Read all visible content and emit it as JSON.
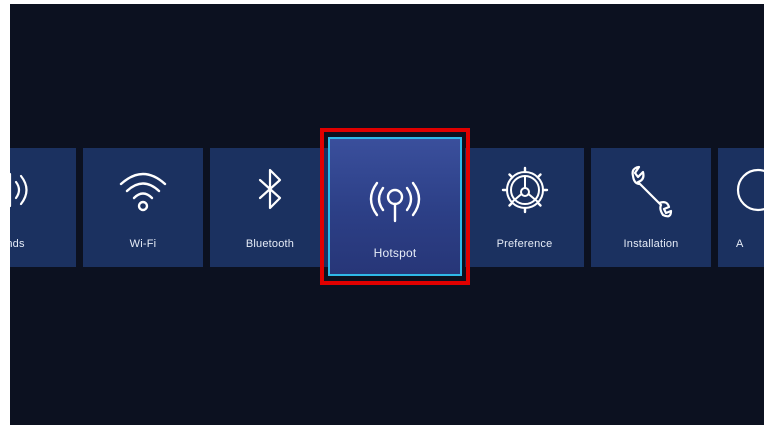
{
  "menu": {
    "items": [
      {
        "label": "unds",
        "icon": "speaker-icon"
      },
      {
        "label": "Wi-Fi",
        "icon": "wifi-icon"
      },
      {
        "label": "Bluetooth",
        "icon": "bluetooth-icon"
      },
      {
        "label": "Hotspot",
        "icon": "hotspot-icon",
        "selected": true
      },
      {
        "label": "Preference",
        "icon": "gear-icon"
      },
      {
        "label": "Installation",
        "icon": "wrench-icon"
      },
      {
        "label": "A",
        "icon": "circle-icon"
      }
    ]
  },
  "colors": {
    "background": "#0c1120",
    "tile": "#1b3160",
    "selected_tile": "#2c3f86",
    "selected_border": "#2fb8e8",
    "highlight": "#e00000",
    "text": "#e6ecf7"
  }
}
